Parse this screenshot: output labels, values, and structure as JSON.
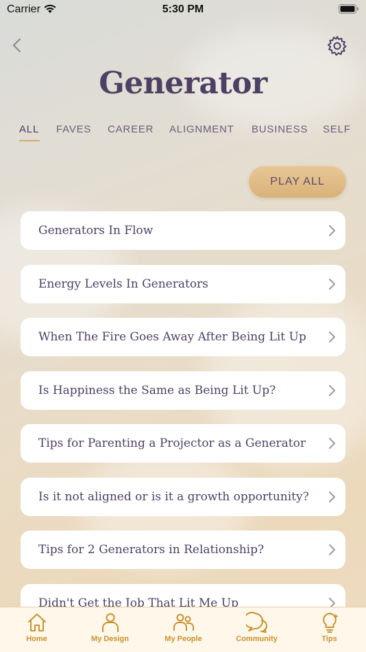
{
  "status_bar": {
    "carrier": "Carrier",
    "time": "5:30 PM"
  },
  "header": {
    "title": "Generator"
  },
  "tabs": [
    {
      "label": "ALL",
      "active": true
    },
    {
      "label": "FAVES",
      "active": false
    },
    {
      "label": "CAREER",
      "active": false
    },
    {
      "label": "ALIGNMENT",
      "active": false
    },
    {
      "label": "BUSINESS",
      "active": false
    },
    {
      "label": "SELF",
      "active": false
    }
  ],
  "play_all_label": "PLAY ALL",
  "list_items": [
    "Generators In Flow",
    "Energy Levels In Generators",
    "When The Fire Goes Away After Being Lit Up",
    "Is Happiness the Same as Being Lit Up?",
    "Tips for Parenting a Projector as a Generator",
    "Is it not aligned or is it a growth opportunity?",
    "Tips for 2 Generators in Relationship?",
    "Didn't Get the Job That Lit Me Up"
  ],
  "tab_bar": [
    {
      "label": "Home",
      "icon": "home-icon"
    },
    {
      "label": "My Design",
      "icon": "person-icon"
    },
    {
      "label": "My People",
      "icon": "people-icon"
    },
    {
      "label": "Community",
      "icon": "chat-bubbles-icon"
    },
    {
      "label": "Tips",
      "icon": "lightbulb-icon"
    }
  ],
  "colors": {
    "accent": "#c9922f",
    "title": "#4e4064",
    "play_button": "#e3bf88",
    "tab_underline": "#d5a96a"
  }
}
